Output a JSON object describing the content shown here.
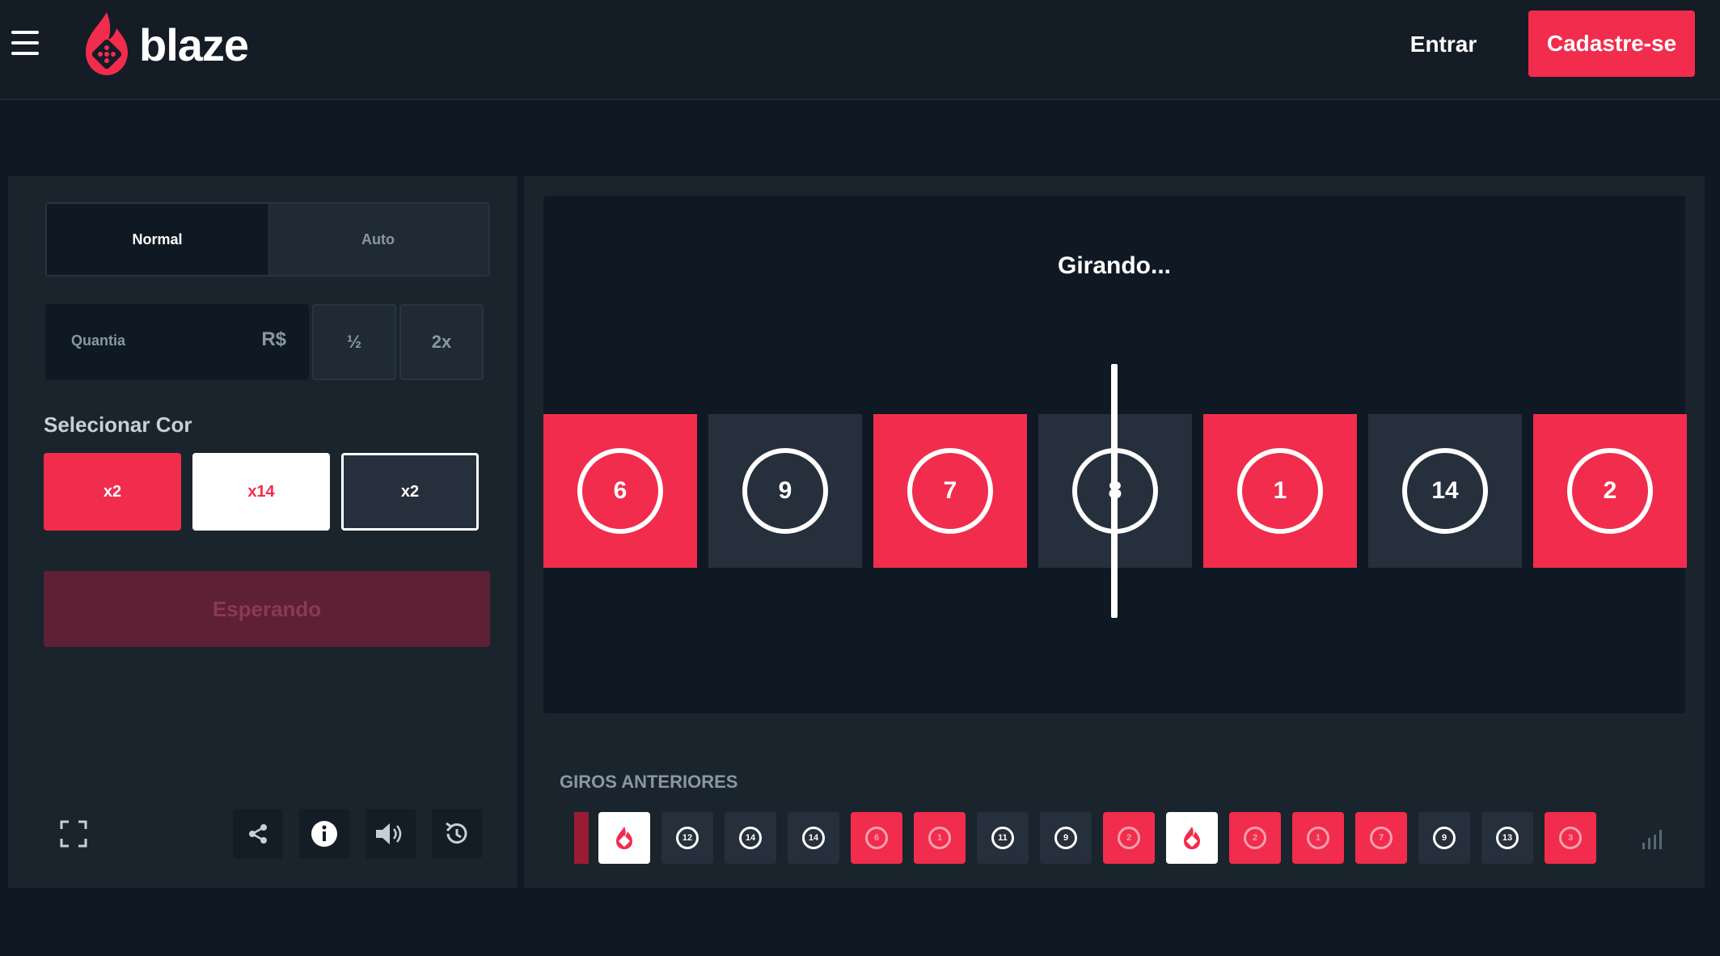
{
  "header": {
    "logo_text": "blaze",
    "login_label": "Entrar",
    "signup_label": "Cadastre-se"
  },
  "bet_panel": {
    "mode_tabs": [
      "Normal",
      "Auto"
    ],
    "active_mode": "Normal",
    "amount_label": "Quantia",
    "currency": "R$",
    "half_label": "½",
    "double_label": "2x",
    "select_color_label": "Selecionar Cor",
    "color_options": [
      {
        "color": "red",
        "multiplier": "x2"
      },
      {
        "color": "white",
        "multiplier": "x14"
      },
      {
        "color": "black",
        "multiplier": "x2"
      }
    ],
    "submit_label": "Esperando",
    "toolbar_icons": [
      "fullscreen-icon",
      "share-icon",
      "info-icon",
      "volume-icon",
      "history-icon"
    ]
  },
  "roulette": {
    "status": "Girando...",
    "tiles": [
      {
        "number": "6",
        "color": "red"
      },
      {
        "number": "9",
        "color": "black"
      },
      {
        "number": "7",
        "color": "red"
      },
      {
        "number": "8",
        "color": "black"
      },
      {
        "number": "1",
        "color": "red"
      },
      {
        "number": "14",
        "color": "black"
      },
      {
        "number": "2",
        "color": "red"
      }
    ]
  },
  "history": {
    "title": "GIROS ANTERIORES",
    "items": [
      {
        "color": "white",
        "number": ""
      },
      {
        "color": "black",
        "number": "12"
      },
      {
        "color": "black",
        "number": "14"
      },
      {
        "color": "black",
        "number": "14"
      },
      {
        "color": "red",
        "number": "6"
      },
      {
        "color": "red",
        "number": "1"
      },
      {
        "color": "black",
        "number": "11"
      },
      {
        "color": "black",
        "number": "9"
      },
      {
        "color": "red",
        "number": "2"
      },
      {
        "color": "white",
        "number": ""
      },
      {
        "color": "red",
        "number": "2"
      },
      {
        "color": "red",
        "number": "1"
      },
      {
        "color": "red",
        "number": "7"
      },
      {
        "color": "black",
        "number": "9"
      },
      {
        "color": "black",
        "number": "13"
      },
      {
        "color": "red",
        "number": "3"
      }
    ]
  },
  "colors": {
    "background": "#0f1923",
    "panel": "#1a242d",
    "red": "#f12c4c",
    "dark_tile": "#262f3c",
    "white": "#ffffff"
  }
}
